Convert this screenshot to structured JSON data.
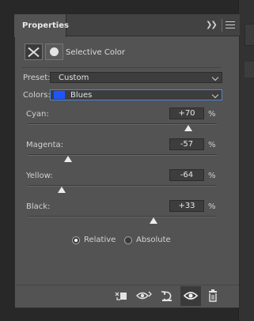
{
  "panel": {
    "tab_title": "Properties",
    "adjustment_title": "Selective Color"
  },
  "preset": {
    "label": "Preset:",
    "value": "Custom"
  },
  "colors": {
    "label": "Colors:",
    "value": "Blues",
    "swatch_color": "#1f55ff"
  },
  "sliders": [
    {
      "label": "Cyan:",
      "value": "+70",
      "unit": "%",
      "level": 0.85
    },
    {
      "label": "Magenta:",
      "value": "-57",
      "unit": "%",
      "level": 0.215
    },
    {
      "label": "Yellow:",
      "value": "-64",
      "unit": "%",
      "level": 0.18
    },
    {
      "label": "Black:",
      "value": "+33",
      "unit": "%",
      "level": 0.665
    }
  ],
  "method": {
    "options": [
      "Relative",
      "Absolute"
    ],
    "selected": "Relative"
  },
  "bottom_icons": [
    "clip-to-layer-icon",
    "view-previous-state-icon",
    "reset-icon",
    "visibility-eye-icon",
    "trash-icon"
  ]
}
